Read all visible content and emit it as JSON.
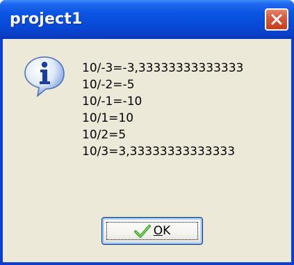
{
  "window": {
    "title": "project1"
  },
  "message": {
    "lines": [
      "10/-3=-3,33333333333333",
      "10/-2=-5",
      "10/-1=-10",
      "10/1=10",
      "10/2=5",
      "10/3=3,33333333333333"
    ]
  },
  "ok_button": {
    "mnemonic": "O",
    "rest": "K",
    "icon": "checkmark-icon"
  },
  "icons": {
    "dialog": "information-icon",
    "close": "close-icon"
  },
  "colors": {
    "titlebar": "#0a54e3",
    "close_button": "#d95a3c",
    "client_background": "#ece9d8",
    "check": "#3aa62a"
  }
}
